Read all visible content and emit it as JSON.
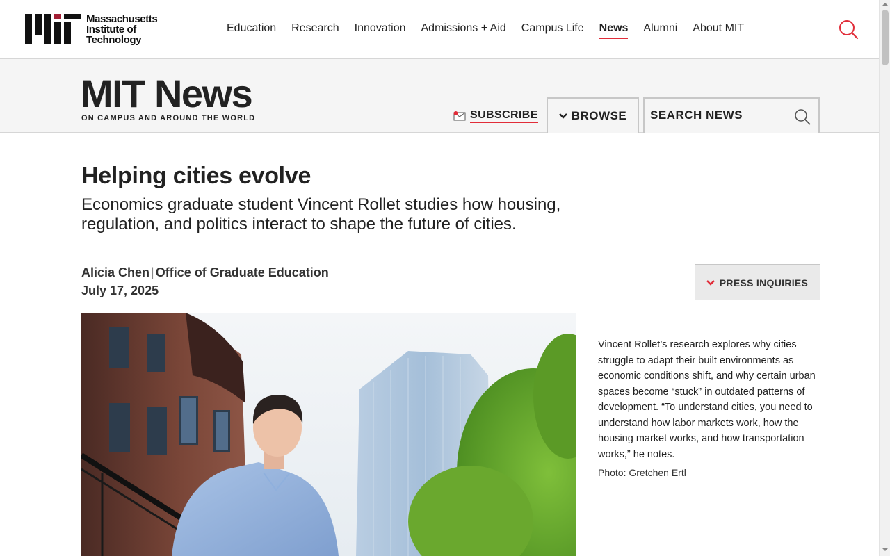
{
  "logo": {
    "line1": "Massachusetts",
    "line2": "Institute of",
    "line3": "Technology"
  },
  "nav": {
    "items": [
      "Education",
      "Research",
      "Innovation",
      "Admissions + Aid",
      "Campus Life",
      "News",
      "Alumni",
      "About MIT"
    ],
    "active": "News"
  },
  "news_header": {
    "title": "MIT News",
    "tagline": "ON CAMPUS AND AROUND THE WORLD",
    "subscribe_label": "SUBSCRIBE",
    "browse_label": "BROWSE",
    "search_placeholder": "SEARCH NEWS"
  },
  "article": {
    "title": "Helping cities evolve",
    "dek": "Economics graduate student Vincent Rollet studies how housing, regulation, and politics interact to shape the future of cities.",
    "author": "Alicia Chen",
    "office": "Office of Graduate Education",
    "date": "July 17, 2025",
    "press_label": "PRESS INQUIRIES",
    "caption": "Vincent Rollet’s research explores why cities struggle to adapt their built environments as economic conditions shift, and why certain urban spaces become “stuck” in outdated patterns of development. “To understand cities, you need to understand how labor markets work, how the housing market works, and how transportation works,” he notes.",
    "credit": "Photo: Gretchen Ertl"
  },
  "colors": {
    "accent": "#e12d39",
    "band": "#f5f5f5",
    "text": "#222222"
  },
  "icons": {
    "top_search": "search-icon",
    "subscribe": "envelope-icon",
    "browse": "chevron-down-icon",
    "search_news": "search-icon",
    "press": "chevron-down-icon"
  }
}
